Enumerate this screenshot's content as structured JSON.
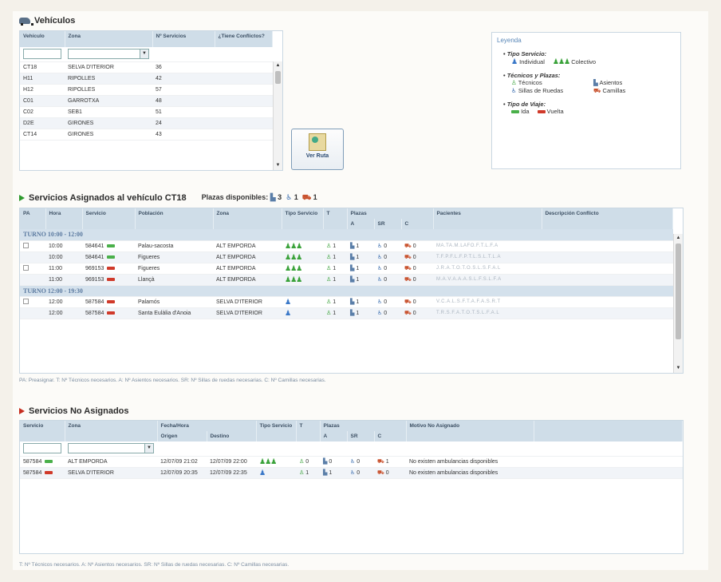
{
  "vehiculos": {
    "title": "Vehículos",
    "headers": [
      "Vehículo",
      "Zona",
      "Nº Servicios",
      "¿Tiene Conflictos?"
    ],
    "rows": [
      {
        "vehiculo": "CT18",
        "zona": "SELVA D'ITERIOR",
        "servicios": "36"
      },
      {
        "vehiculo": "H11",
        "zona": "RIPOLLES",
        "servicios": "42"
      },
      {
        "vehiculo": "H12",
        "zona": "RIPOLLES",
        "servicios": "57"
      },
      {
        "vehiculo": "C01",
        "zona": "GARROTXA",
        "servicios": "48"
      },
      {
        "vehiculo": "C02",
        "zona": "SEB1",
        "servicios": "51"
      },
      {
        "vehiculo": "D2E",
        "zona": "GIRONES",
        "servicios": "24"
      },
      {
        "vehiculo": "CT14",
        "zona": "GIRONES",
        "servicios": "43"
      }
    ]
  },
  "ver_ruta": {
    "label": "Ver Ruta"
  },
  "leyenda": {
    "title": "Leyenda",
    "tipo_servicio": {
      "heading": "Tipo Servicio:",
      "individual": "Individual",
      "colectivo": "Colectivo"
    },
    "tecnicos_plazas": {
      "heading": "Técnicos y Plazas:",
      "tecnicos": "Técnicos",
      "asientos": "Asientos",
      "sillas": "Sillas de Ruedas",
      "camillas": "Camillas"
    },
    "tipo_viaje": {
      "heading": "Tipo de Viaje:",
      "ida": "Ida",
      "vuelta": "Vuelta"
    }
  },
  "asignados": {
    "title": "Servicios Asignados al vehículo CT18",
    "plazas_label": "Plazas disponibles:",
    "plazas_a": "3",
    "plazas_sr": "1",
    "plazas_c": "1",
    "headers": [
      "PA",
      "Hora",
      "Servicio",
      "Población",
      "Zona",
      "Tipo Servicio",
      "T",
      "Plazas",
      "Pacientes",
      "Descripción Conflicto"
    ],
    "plazas_sub": [
      "A",
      "SR",
      "C"
    ],
    "turnos": [
      {
        "label": "TURNO 10:00 - 12:00",
        "rows": [
          {
            "checkbox": true,
            "hora": "10:00",
            "servicio": "584641",
            "dir": "ida",
            "poblacion": "Palau-sacosta",
            "zona": "ALT EMPORDA",
            "tipo": "colectivo",
            "t": "1",
            "a": "1",
            "sr": "0",
            "c": "0",
            "pacientes": "MA.TA.M.LAFO.F.T.L.F.A"
          },
          {
            "checkbox": false,
            "hora": "10:00",
            "servicio": "584641",
            "dir": "ida",
            "poblacion": "Figueres",
            "zona": "ALT EMPORDA",
            "tipo": "colectivo",
            "t": "1",
            "a": "1",
            "sr": "0",
            "c": "0",
            "pacientes": "T.F.P.F.L.F.P.T.L.S.L.T.L.A"
          },
          {
            "checkbox": true,
            "hora": "11:00",
            "servicio": "969153",
            "dir": "vuelta",
            "poblacion": "Figueres",
            "zona": "ALT EMPORDA",
            "tipo": "colectivo",
            "t": "1",
            "a": "1",
            "sr": "0",
            "c": "0",
            "pacientes": "J.R.A.T.O.T.O.S.L.S.F.A.L"
          },
          {
            "checkbox": false,
            "hora": "11:00",
            "servicio": "969153",
            "dir": "vuelta",
            "poblacion": "Llançà",
            "zona": "ALT EMPORDA",
            "tipo": "colectivo",
            "t": "1",
            "a": "1",
            "sr": "0",
            "c": "0",
            "pacientes": "M.A.V.A.A.A.S.L.F.S.L.F.A"
          }
        ]
      },
      {
        "label": "TURNO 12:00 - 19:30",
        "rows": [
          {
            "checkbox": true,
            "hora": "12:00",
            "servicio": "587584",
            "dir": "vuelta",
            "poblacion": "Palamós",
            "zona": "SELVA D'ITERIOR",
            "tipo": "individual",
            "t": "1",
            "a": "1",
            "sr": "0",
            "c": "0",
            "pacientes": "V.C.A.L.S.F.T.A.F.A.S.R.T"
          },
          {
            "checkbox": false,
            "hora": "12:00",
            "servicio": "587584",
            "dir": "vuelta",
            "poblacion": "Santa Eulàlia d'Anoia",
            "zona": "SELVA D'ITERIOR",
            "tipo": "individual",
            "t": "1",
            "a": "1",
            "sr": "0",
            "c": "0",
            "pacientes": "T.R.S.F.A.T.O.T.S.L.F.A.L"
          }
        ]
      }
    ],
    "footnote": "PA: Preasignar.  T: Nº Técnicos necesarios.  A: Nº Asientos necesarios.  SR: Nº Sillas de ruedas necesarias.  C: Nº Camillas necesarias."
  },
  "no_asignados": {
    "title": "Servicios No Asignados",
    "headers": [
      "Servicio",
      "Zona",
      "Fecha/Hora",
      "Tipo Servicio",
      "T",
      "Plazas",
      "Motivo No Asignado"
    ],
    "fecha_sub": [
      "Origen",
      "Destino"
    ],
    "plazas_sub": [
      "A",
      "SR",
      "C"
    ],
    "rows": [
      {
        "servicio": "587584",
        "dir": "ida",
        "zona": "ALT EMPORDA",
        "origen": "12/07/09 21:02",
        "destino": "12/07/09 22:00",
        "tipo": "colectivo",
        "t": "0",
        "a": "0",
        "sr": "0",
        "c": "1",
        "motivo": "No existen ambulancias disponibles"
      },
      {
        "servicio": "587584",
        "dir": "vuelta",
        "zona": "SELVA D'ITERIOR",
        "origen": "12/07/09 20:35",
        "destino": "12/07/09 22:35",
        "tipo": "individual",
        "t": "1",
        "a": "1",
        "sr": "0",
        "c": "0",
        "motivo": "No existen ambulancias disponibles"
      }
    ],
    "footnote": "T: Nº Técnicos necesarios.  A: Nº Asientos necesarios.  SR: Nº Sillas de ruedas necesarias.  C: Nº Camillas necesarias."
  }
}
